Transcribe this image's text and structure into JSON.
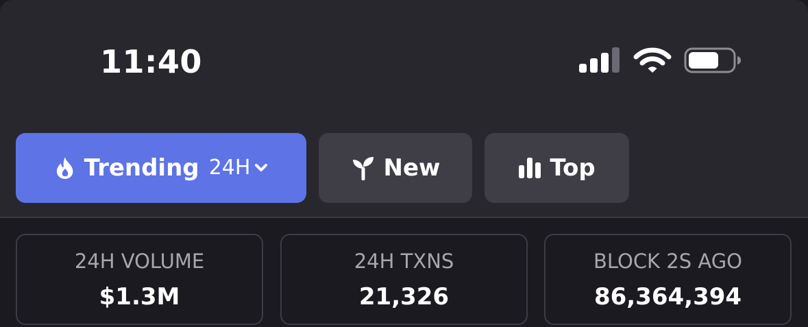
{
  "status_bar": {
    "time": "11:40",
    "icons": [
      "cellular-signal-icon",
      "wifi-icon",
      "battery-icon"
    ]
  },
  "tabs": [
    {
      "label": "Trending",
      "sub": "24H",
      "icon": "flame-icon",
      "active": true
    },
    {
      "label": "New",
      "icon": "sprout-icon",
      "active": false
    },
    {
      "label": "Top",
      "icon": "bar-chart-icon",
      "active": false
    }
  ],
  "stats": [
    {
      "label": "24H VOLUME",
      "value": "$1.3M"
    },
    {
      "label": "24H TXNS",
      "value": "21,326"
    },
    {
      "label": "BLOCK 2S AGO",
      "value": "86,364,394"
    }
  ],
  "colors": {
    "panel_background": "#28272e",
    "page_background": "#1b1a20",
    "accent": "#5d73e6",
    "inactive_tab": "#3f3e46",
    "muted_text": "#a7a6ad"
  }
}
